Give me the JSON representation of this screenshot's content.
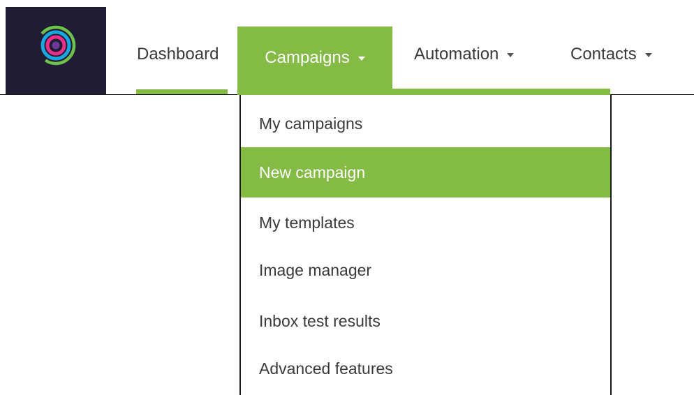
{
  "logo": {
    "icon": "concentric-rings-logo-icon"
  },
  "nav": {
    "dashboard": "Dashboard",
    "campaigns": "Campaigns",
    "automation": "Automation",
    "contacts": "Contacts"
  },
  "dropdown": {
    "items": [
      {
        "label": "My campaigns"
      },
      {
        "label": "New campaign",
        "active": true
      },
      {
        "label": "My templates"
      },
      {
        "label": "Image manager"
      },
      {
        "label": "Inbox test results"
      },
      {
        "label": "Advanced features"
      }
    ]
  },
  "colors": {
    "accent": "#83bb44",
    "logo_background": "#201c34",
    "text": "#3a3a3a"
  }
}
